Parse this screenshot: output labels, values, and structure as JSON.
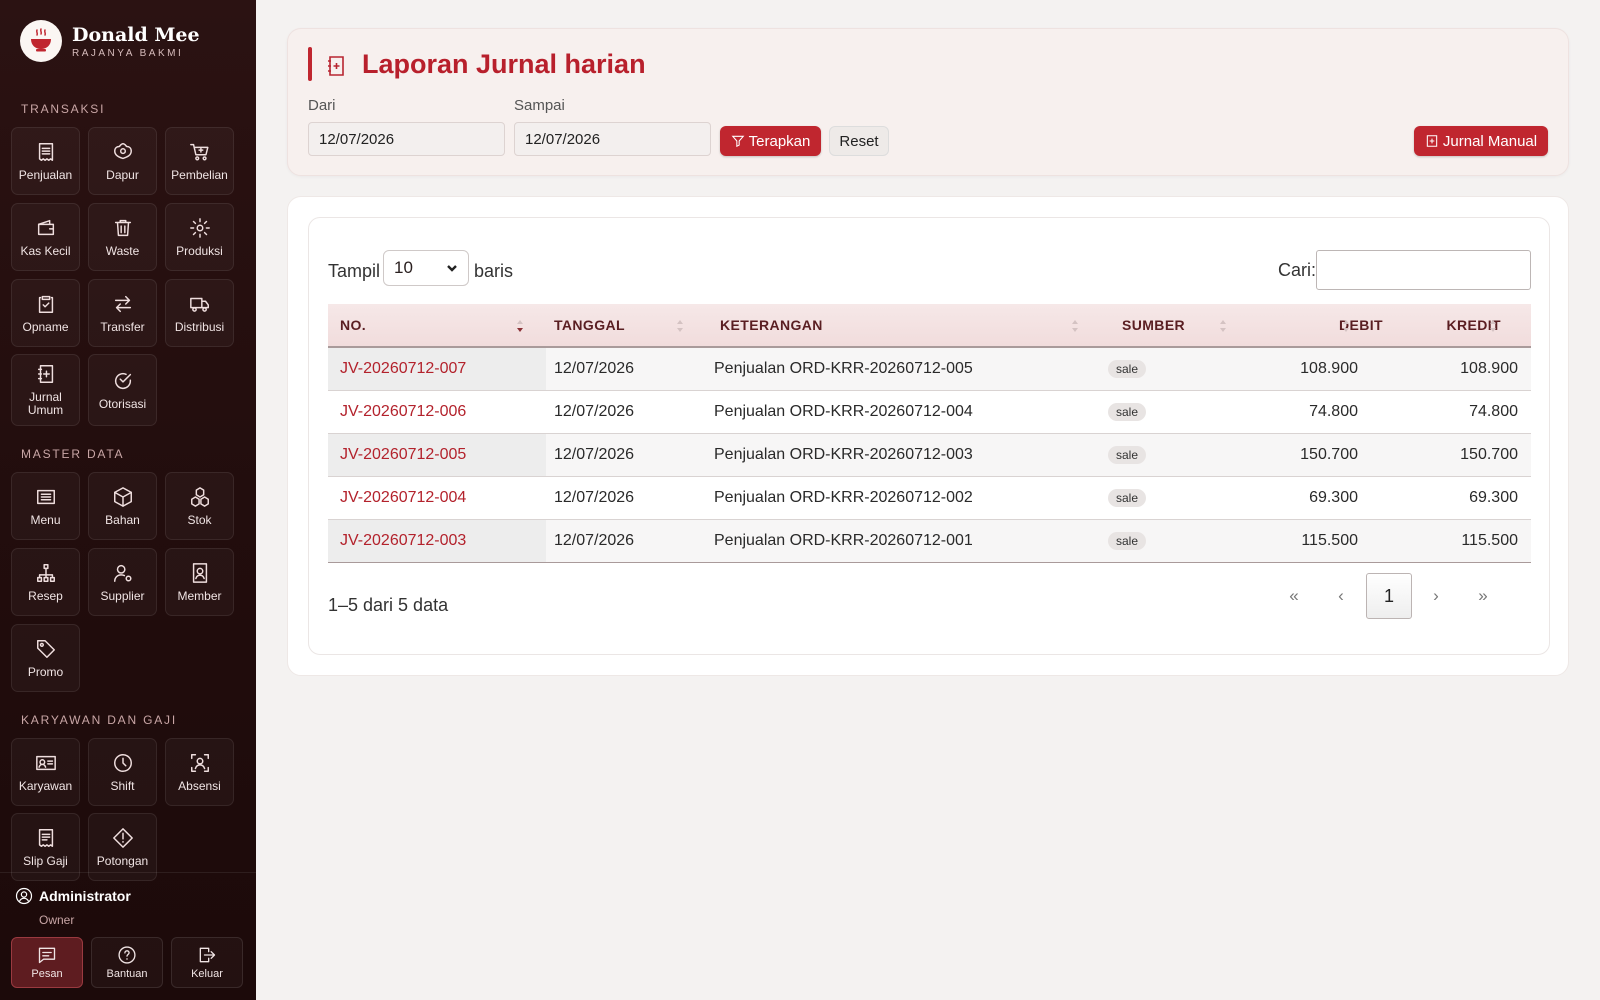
{
  "brand": {
    "name": "Donald Mee",
    "tagline": "RAJANYA BAKMI"
  },
  "sidebar": {
    "sections": [
      {
        "title": "TRANSAKSI",
        "items": [
          {
            "label": "Penjualan",
            "icon": "receipt-icon"
          },
          {
            "label": "Dapur",
            "icon": "dish-icon"
          },
          {
            "label": "Pembelian",
            "icon": "cart-icon"
          },
          {
            "label": "Kas Kecil",
            "icon": "wallet-icon"
          },
          {
            "label": "Waste",
            "icon": "trash-icon"
          },
          {
            "label": "Produksi",
            "icon": "gear-icon"
          },
          {
            "label": "Opname",
            "icon": "clipboard-check-icon"
          },
          {
            "label": "Transfer",
            "icon": "transfer-icon"
          },
          {
            "label": "Distribusi",
            "icon": "truck-icon"
          },
          {
            "label": "Jurnal Umum",
            "icon": "journal-plus-icon"
          },
          {
            "label": "Otorisasi",
            "icon": "check-circle-icon"
          }
        ]
      },
      {
        "title": "MASTER DATA",
        "items": [
          {
            "label": "Menu",
            "icon": "list-icon"
          },
          {
            "label": "Bahan",
            "icon": "box-icon"
          },
          {
            "label": "Stok",
            "icon": "boxes-icon"
          },
          {
            "label": "Resep",
            "icon": "diagram-icon"
          },
          {
            "label": "Supplier",
            "icon": "person-gear-icon"
          },
          {
            "label": "Member",
            "icon": "member-card-icon"
          },
          {
            "label": "Promo",
            "icon": "tag-icon"
          }
        ]
      },
      {
        "title": "KARYAWAN DAN GAJI",
        "items": [
          {
            "label": "Karyawan",
            "icon": "id-card-icon"
          },
          {
            "label": "Shift",
            "icon": "clock-icon"
          },
          {
            "label": "Absensi",
            "icon": "person-scan-icon"
          },
          {
            "label": "Slip Gaji",
            "icon": "payslip-icon"
          },
          {
            "label": "Potongan",
            "icon": "warning-diamond-icon"
          }
        ]
      }
    ],
    "user": {
      "name": "Administrator",
      "role": "Owner"
    },
    "footer_buttons": [
      {
        "label": "Pesan",
        "icon": "chat-icon",
        "active": true
      },
      {
        "label": "Bantuan",
        "icon": "question-circle-icon",
        "active": false
      },
      {
        "label": "Keluar",
        "icon": "logout-icon",
        "active": false
      }
    ]
  },
  "header": {
    "title": "Laporan Jurnal harian",
    "from_label": "Dari",
    "from_value": "12/07/2026",
    "to_label": "Sampai",
    "to_value": "12/07/2026",
    "apply_label": "Terapkan",
    "reset_label": "Reset",
    "manual_label": "Jurnal Manual"
  },
  "table": {
    "length_prefix": "Tampil",
    "length_value": "10",
    "length_suffix": "baris",
    "search_label": "Cari:",
    "search_value": "",
    "columns": [
      "NO.",
      "TANGGAL",
      "KETERANGAN",
      "SUMBER",
      "DEBIT",
      "KREDIT"
    ],
    "rows": [
      {
        "no": "JV-20260712-007",
        "tanggal": "12/07/2026",
        "keterangan": "Penjualan ORD-KRR-20260712-005",
        "sumber": "sale",
        "debit": "108.900",
        "kredit": "108.900"
      },
      {
        "no": "JV-20260712-006",
        "tanggal": "12/07/2026",
        "keterangan": "Penjualan ORD-KRR-20260712-004",
        "sumber": "sale",
        "debit": "74.800",
        "kredit": "74.800"
      },
      {
        "no": "JV-20260712-005",
        "tanggal": "12/07/2026",
        "keterangan": "Penjualan ORD-KRR-20260712-003",
        "sumber": "sale",
        "debit": "150.700",
        "kredit": "150.700"
      },
      {
        "no": "JV-20260712-004",
        "tanggal": "12/07/2026",
        "keterangan": "Penjualan ORD-KRR-20260712-002",
        "sumber": "sale",
        "debit": "69.300",
        "kredit": "69.300"
      },
      {
        "no": "JV-20260712-003",
        "tanggal": "12/07/2026",
        "keterangan": "Penjualan ORD-KRR-20260712-001",
        "sumber": "sale",
        "debit": "115.500",
        "kredit": "115.500"
      }
    ],
    "info": "1–5 dari 5 data",
    "pagination": {
      "first": "«",
      "prev": "‹",
      "current": "1",
      "next": "›",
      "last": "»"
    }
  }
}
